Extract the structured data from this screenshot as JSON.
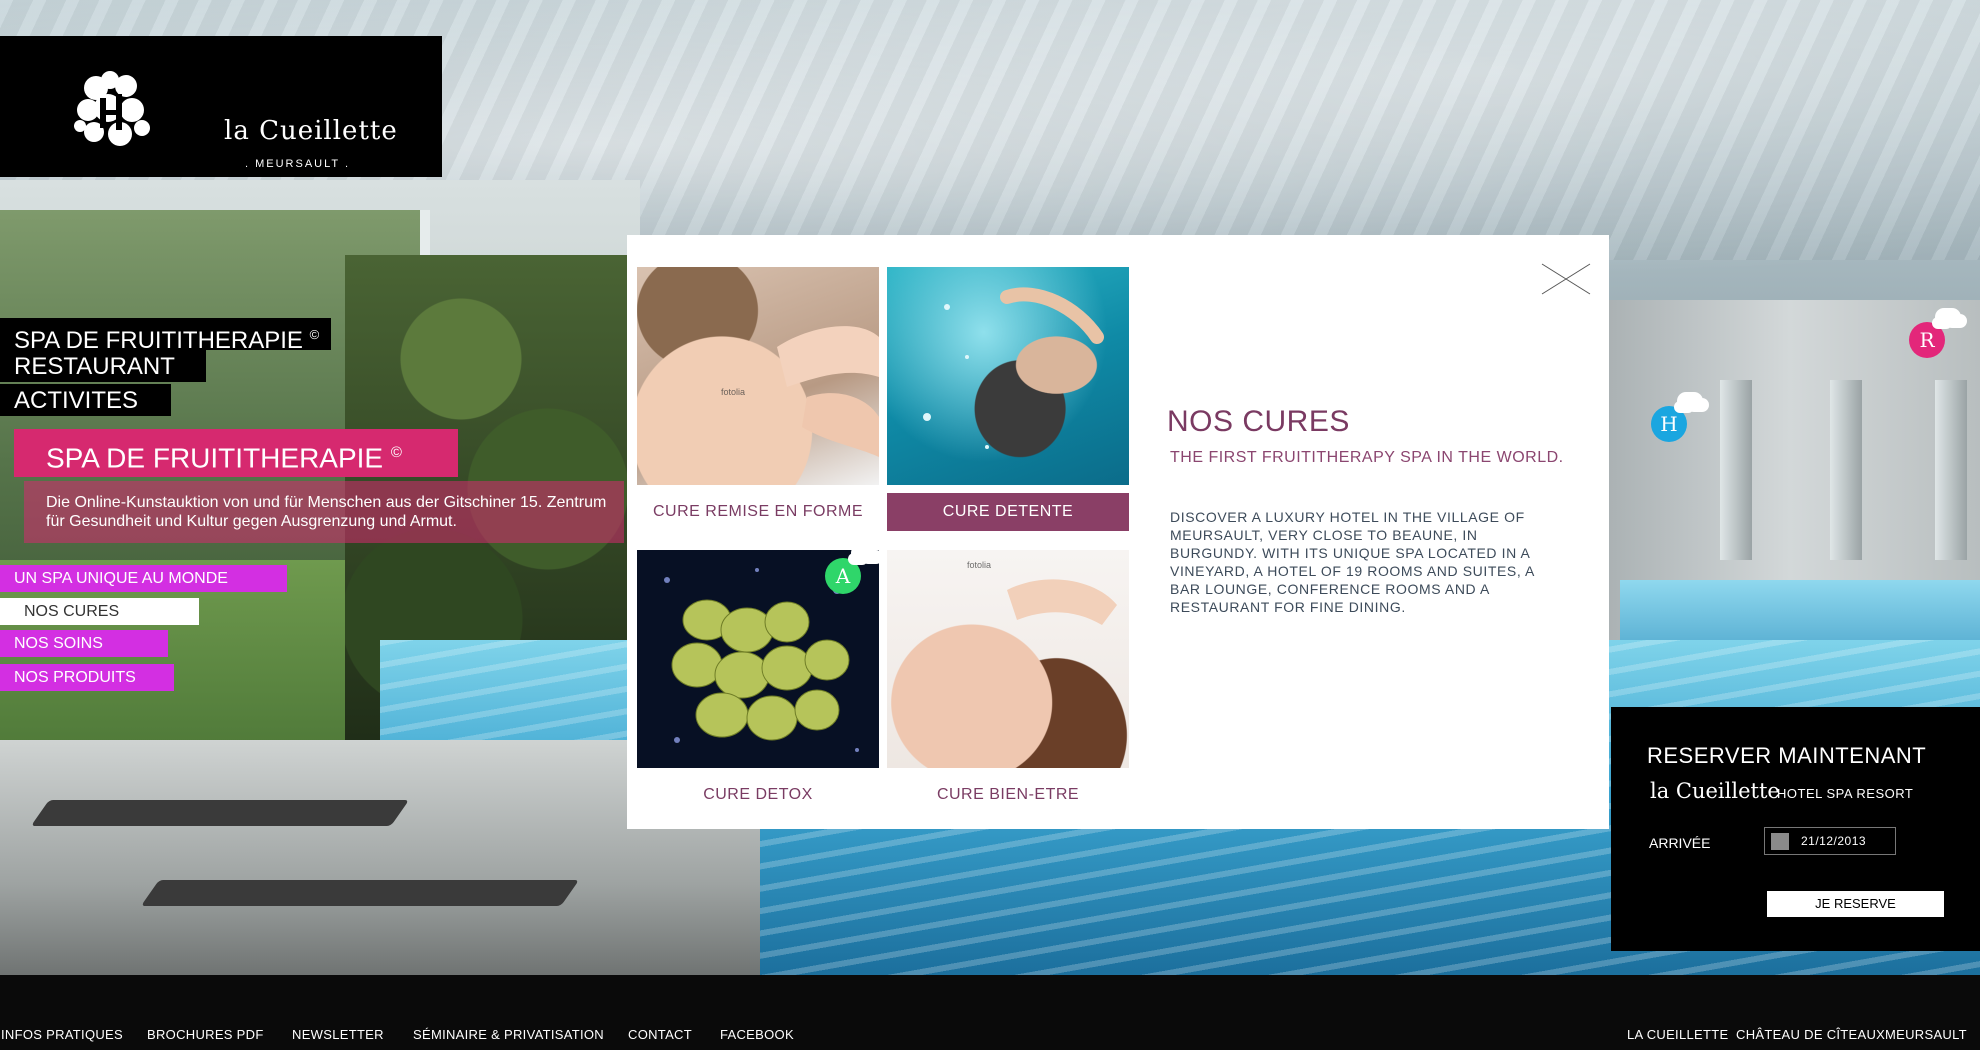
{
  "brand": {
    "name": "la Cueillette",
    "location": ". MEURSAULT ."
  },
  "main_nav": [
    {
      "label": "SPA DE FRUITITHERAPIE",
      "sup": "©"
    },
    {
      "label": "RESTAURANT"
    },
    {
      "label": "ACTIVITES"
    }
  ],
  "section": {
    "title": "SPA DE FRUITITHERAPIE",
    "title_sup": "©",
    "description": "Die Online-Kunstauktion von und für Menschen aus der Gitschiner 15. Zentrum für Gesundheit und Kultur gegen Ausgrenzung und Armut."
  },
  "sub_nav": [
    {
      "label": "UN SPA UNIQUE AU MONDE",
      "active": false
    },
    {
      "label": "NOS CURES",
      "active": true
    },
    {
      "label": "NOS SOINS",
      "active": false
    },
    {
      "label": "NOS PRODUITS",
      "active": false
    }
  ],
  "modal": {
    "tiles": [
      {
        "caption": "CURE REMISE EN FORME",
        "active": false,
        "watermark": "fotolia"
      },
      {
        "caption": "CURE DETENTE",
        "active": true
      },
      {
        "caption": "CURE DETOX",
        "active": false,
        "badge": "A"
      },
      {
        "caption": "CURE BIEN-ETRE",
        "active": false,
        "watermark": "fotolia"
      }
    ],
    "title": "NOS CURES",
    "subtitle": "THE FIRST FRUITITHERAPY SPA IN THE WORLD.",
    "body": "DISCOVER A LUXURY HOTEL IN THE VILLAGE OF MEURSAULT, VERY CLOSE TO BEAUNE, IN BURGUNDY. WITH ITS UNIQUE SPA LOCATED IN A VINEYARD, A HOTEL OF 19 ROOMS AND SUITES, A BAR LOUNGE, CONFERENCE ROOMS AND A RESTAURANT FOR FINE DINING."
  },
  "badges": {
    "r": {
      "letter": "R",
      "color": "#e3277a"
    },
    "h": {
      "letter": "H",
      "color": "#1aa6e0"
    },
    "a": {
      "letter": "A",
      "color": "#2fd66a"
    }
  },
  "reservation": {
    "title": "RESERVER MAINTENANT",
    "brand": "la Cueillette",
    "tagline": "HOTEL SPA RESORT",
    "arrival_label": "ARRIVÉE",
    "arrival_value": "21/12/2013",
    "button": "JE RESERVE"
  },
  "footer": {
    "left": [
      "INFOS PRATIQUES",
      "BROCHURES PDF",
      "NEWSLETTER",
      "SÉMINAIRE & PRIVATISATION",
      "CONTACT",
      "FACEBOOK"
    ],
    "right": [
      "LA CUEILLETTE",
      "CHÂTEAU DE CÎTEAUX",
      "MEURSAULT"
    ]
  },
  "colors": {
    "accent_pink": "#d6296f",
    "subnav_magenta": "#d32fe2",
    "plum": "#8a3f66"
  }
}
